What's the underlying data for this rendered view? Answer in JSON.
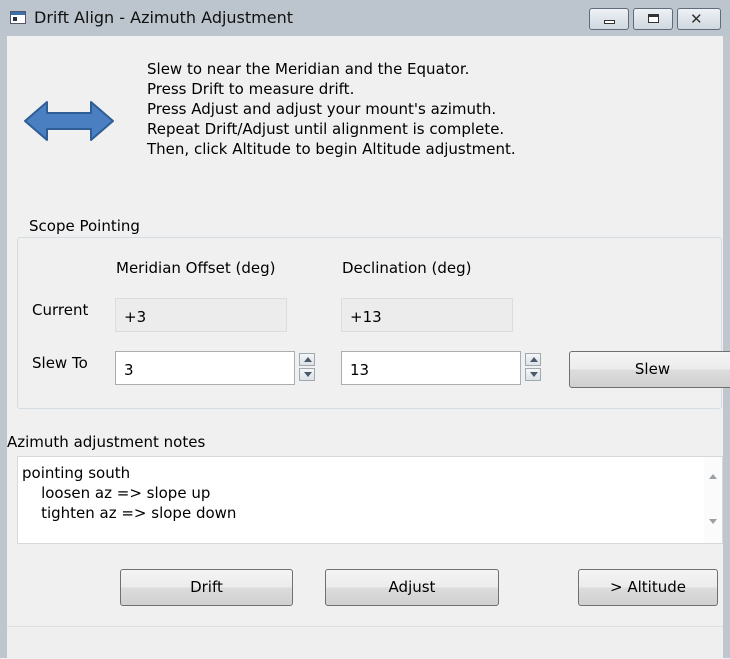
{
  "window": {
    "title": "Drift Align - Azimuth Adjustment"
  },
  "icons": {
    "app": "app-window-icon",
    "minimize": "minimize-icon",
    "maximize": "maximize-icon",
    "close": "close-icon",
    "direction": "left-right-arrow-icon"
  },
  "instructions": [
    "Slew to near the Meridian and the Equator.",
    "Press Drift to measure drift.",
    "Press Adjust and adjust your mount's azimuth.",
    "Repeat Drift/Adjust until alignment is complete.",
    "Then, click Altitude to begin Altitude adjustment."
  ],
  "scope": {
    "group_title": "Scope Pointing",
    "col_meridian": "Meridian Offset (deg)",
    "col_declination": "Declination (deg)",
    "current_label": "Current",
    "slewto_label": "Slew To",
    "current_meridian": "+3",
    "current_declination": "+13",
    "slewto_meridian": "3",
    "slewto_declination": "13",
    "slew_button": "Slew"
  },
  "notes": {
    "label": "Azimuth adjustment notes",
    "text": "pointing south\n    loosen az => slope up\n    tighten az => slope down"
  },
  "buttons": {
    "drift": "Drift",
    "adjust": "Adjust",
    "altitude": "> Altitude"
  },
  "colors": {
    "arrow_fill": "#4a7fc1",
    "arrow_stroke": "#2f5d96"
  }
}
